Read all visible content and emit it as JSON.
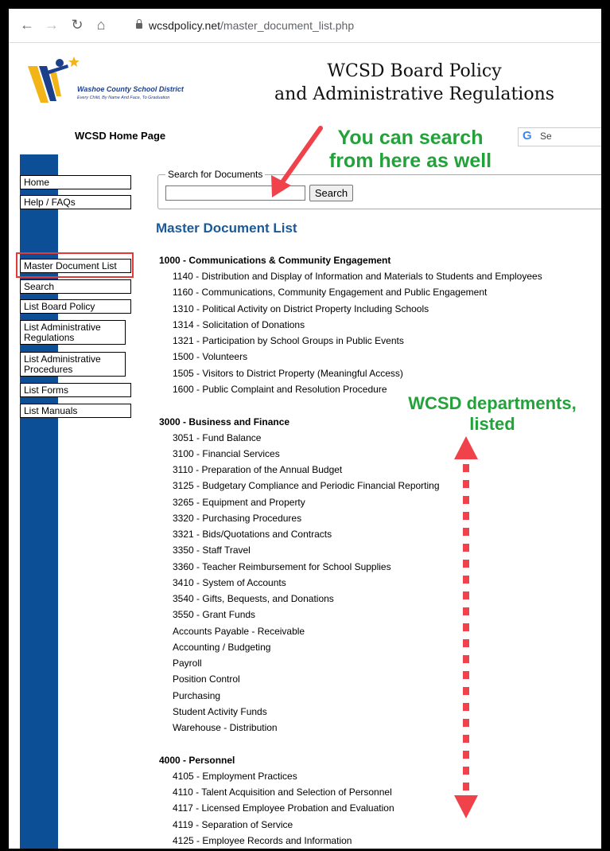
{
  "browser": {
    "url_host": "wcsdpolicy.net",
    "url_path": "/master_document_list.php"
  },
  "header": {
    "logo_name": "Washoe County School District",
    "logo_tagline": "Every Child, By Name And Face, To Graduation",
    "title_line1": "WCSD Board Policy",
    "title_line2": "and Administrative Regulations",
    "home_link": "WCSD Home Page",
    "google_search_label": "Se"
  },
  "sidebar": {
    "items": [
      {
        "label": "Home"
      },
      {
        "label": "Help / FAQs"
      },
      {
        "label": "Master Document List"
      },
      {
        "label": "Search"
      },
      {
        "label": "List Board Policy"
      },
      {
        "label": "List Administrative Regulations"
      },
      {
        "label": "List Administrative Procedures"
      },
      {
        "label": "List Forms"
      },
      {
        "label": "List Manuals"
      }
    ]
  },
  "search": {
    "legend": "Search for Documents",
    "input_value": "",
    "button_label": "Search"
  },
  "main": {
    "heading": "Master Document List",
    "categories": [
      {
        "title": "1000 - Communications & Community Engagement",
        "items": [
          "1140 - Distribution and Display of Information and Materials to Students and Employees",
          "1160 - Communications, Community Engagement and Public Engagement",
          "1310 - Political Activity on District Property Including Schools",
          "1314 - Solicitation of Donations",
          "1321 - Participation by School Groups in Public Events",
          "1500 - Volunteers",
          "1505 - Visitors to District Property (Meaningful Access)",
          "1600 - Public Complaint and Resolution Procedure"
        ]
      },
      {
        "title": "3000 - Business and Finance",
        "items": [
          "3051 - Fund Balance",
          "3100 - Financial Services",
          "3110 - Preparation of the Annual Budget",
          "3125 - Budgetary Compliance and Periodic Financial Reporting",
          "3265 - Equipment and Property",
          "3320 - Purchasing Procedures",
          "3321 - Bids/Quotations and Contracts",
          "3350 - Staff Travel",
          "3360 - Teacher Reimbursement for School Supplies",
          "3410 - System of Accounts",
          "3540 - Gifts, Bequests, and Donations",
          "3550 - Grant Funds",
          "Accounts Payable - Receivable",
          "Accounting / Budgeting",
          "Payroll",
          "Position Control",
          "Purchasing",
          "Student Activity Funds",
          "Warehouse - Distribution"
        ]
      },
      {
        "title": "4000 - Personnel",
        "items": [
          "4105 - Employment Practices",
          "4110 - Talent Acquisition and Selection of Personnel",
          "4117 - Licensed Employee Probation and Evaluation",
          "4119 - Separation of Service",
          "4125 - Employee Records and Information"
        ]
      }
    ]
  },
  "annotations": {
    "search_note_line1": "You can search",
    "search_note_line2": "from here as well",
    "departments_note_line1": "WCSD departments,",
    "departments_note_line2": "listed",
    "highlight_color": "#e53935",
    "note_color": "#21a33a"
  }
}
